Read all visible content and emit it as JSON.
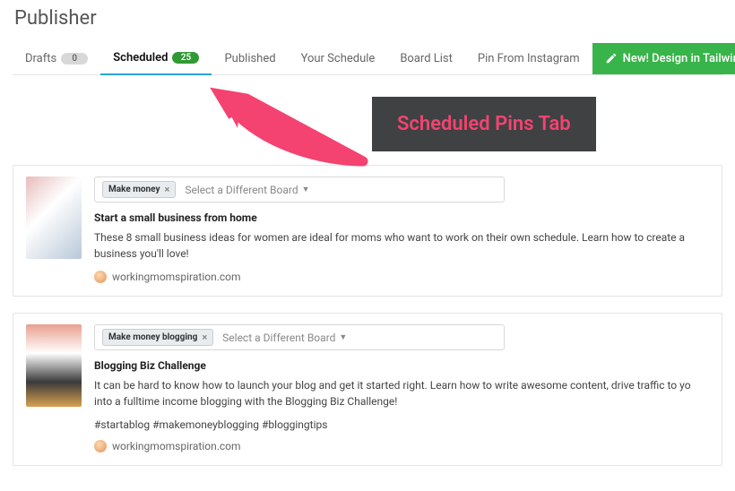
{
  "page_title": "Publisher",
  "tabs": {
    "drafts": {
      "label": "Drafts",
      "count": "0"
    },
    "scheduled": {
      "label": "Scheduled",
      "count": "25"
    },
    "published": {
      "label": "Published"
    },
    "your_schedule": {
      "label": "Your Schedule"
    },
    "board_list": {
      "label": "Board List"
    },
    "pin_from_instagram": {
      "label": "Pin From Instagram"
    }
  },
  "new_button": "New! Design in Tailwin",
  "annotation_label": "Scheduled Pins Tab",
  "board_select_placeholder": "Select a Different Board",
  "pins": [
    {
      "board_tag": "Make money",
      "title": "Start a small business from home",
      "description": "These 8 small business ideas for women are ideal for moms who want to work on their own schedule. Learn how to create a business you'll love!",
      "hashtags": "",
      "source": "workingmomspiration.com"
    },
    {
      "board_tag": "Make money blogging",
      "title": "Blogging Biz Challenge",
      "description": "It can be hard to know how to launch your blog and get it started right. Learn how to write awesome content, drive traffic to yo into a fulltime income blogging with the Blogging Biz Challenge!",
      "hashtags": "#startablog #makemoneyblogging #bloggingtips",
      "source": "workingmomspiration.com"
    }
  ]
}
